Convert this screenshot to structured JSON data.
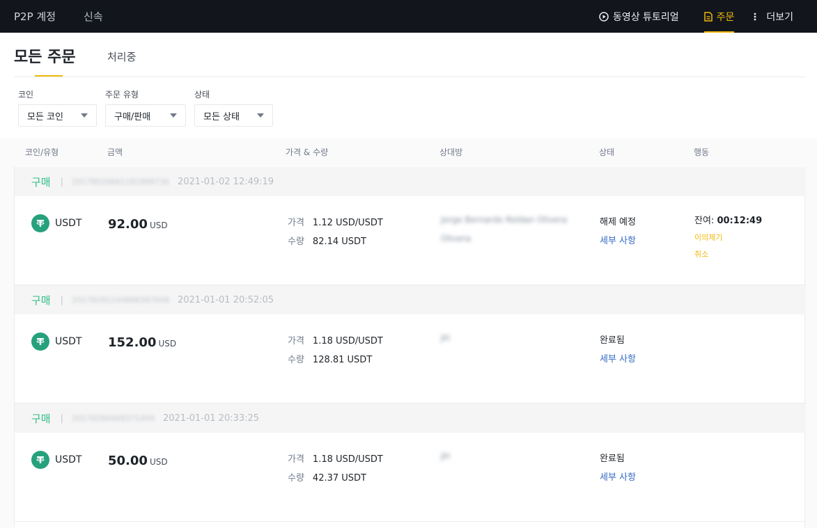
{
  "topnav": {
    "left_items": [
      "P2P 계정",
      "신속"
    ],
    "tutorial": "동영상 튜토리얼",
    "orders": "주문",
    "more": "더보기"
  },
  "header": {
    "title": "모든 주문",
    "tab_processing": "처리중"
  },
  "filters": [
    {
      "label": "코인",
      "value": "모든 코인"
    },
    {
      "label": "주문 유형",
      "value": "구매/판매"
    },
    {
      "label": "상태",
      "value": "모든 상태"
    }
  ],
  "columns": [
    "코인/유형",
    "금액",
    "가격 & 수량",
    "상대방",
    "상태",
    "행동"
  ],
  "labels": {
    "price": "가격",
    "quantity": "수량",
    "detail": "세부 사항",
    "remaining": "잔여:"
  },
  "orders": [
    {
      "side": "구매",
      "order_no": "20178020661181999736",
      "time": "2021-01-02 12:49:19",
      "coin": "USDT",
      "amount": "92.00",
      "amount_unit": "USD",
      "price": "1.12 USD/USDT",
      "quantity": "82.14 USDT",
      "counterparty": [
        "Jorge Bernardo Roldan Olivera",
        "Olivera"
      ],
      "status": "해제 예정",
      "remaining_time": "00:12:49",
      "actions": [
        "이의제기",
        "취소"
      ]
    },
    {
      "side": "구매",
      "order_no": "20178291144898387948",
      "time": "2021-01-01 20:52:05",
      "coin": "USDT",
      "amount": "152.00",
      "amount_unit": "USD",
      "price": "1.18 USD/USDT",
      "quantity": "128.81 USDT",
      "counterparty": [
        "JH"
      ],
      "status": "완료됨",
      "actions": []
    },
    {
      "side": "구매",
      "order_no": "20178284468371494",
      "time": "2021-01-01 20:33:25",
      "coin": "USDT",
      "amount": "50.00",
      "amount_unit": "USD",
      "price": "1.18 USD/USDT",
      "quantity": "42.37 USDT",
      "counterparty": [
        "JH"
      ],
      "status": "완료됨",
      "actions": []
    }
  ],
  "colors": {
    "nav_bg": "#12161c",
    "accent": "#f0b90b",
    "buy": "#2ebd85",
    "usdt": "#26a17b",
    "link": "#356ac3"
  }
}
